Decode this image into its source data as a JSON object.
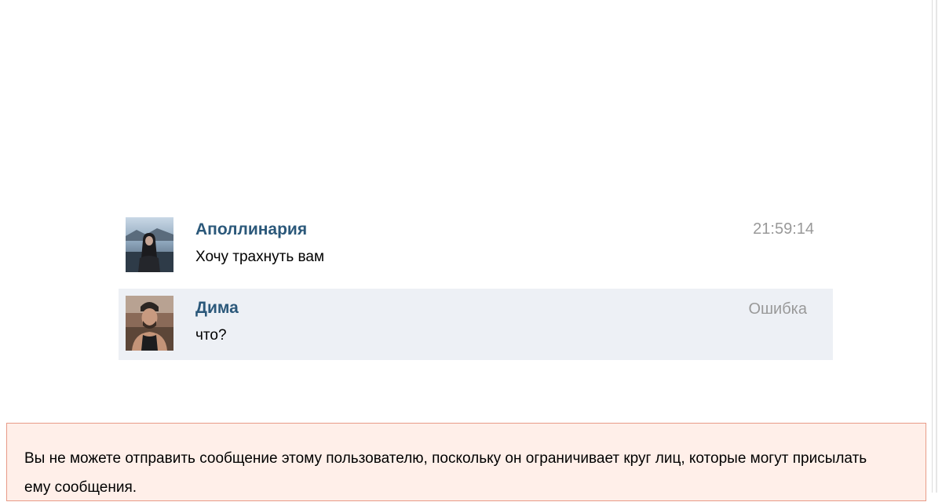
{
  "messages": [
    {
      "author": "Аполлинария",
      "text": "Хочу трахнуть вам",
      "time": "21:59:14",
      "avatar_icon": "avatar-woman-icon",
      "highlighted": false
    },
    {
      "author": "Дима",
      "text": "что?",
      "time": "Ошибка",
      "avatar_icon": "avatar-man-icon",
      "highlighted": true
    }
  ],
  "notice": {
    "text": "Вы не можете отправить сообщение этому пользователю, поскольку он ограничивает круг лиц, которые могут присылать ему сообщения."
  },
  "colors": {
    "author_link": "#2b587a",
    "highlight_bg": "#edf0f5",
    "notice_bg": "#ffefe9",
    "notice_border": "#e89b88",
    "timestamp": "#999999"
  }
}
